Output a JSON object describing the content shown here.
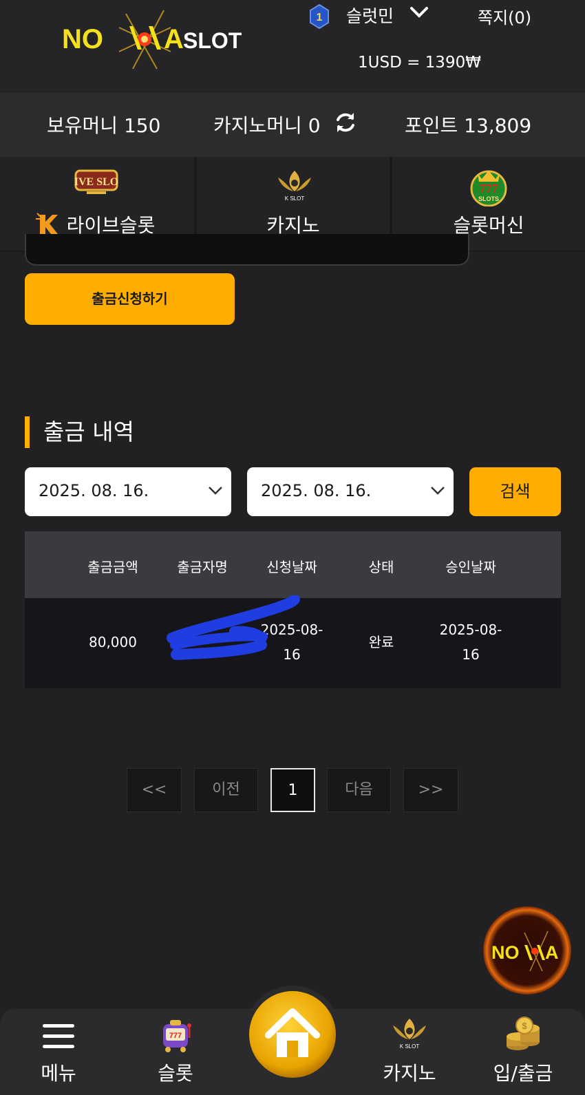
{
  "header": {
    "logo_text": "NOVA SLOT",
    "level": "1",
    "username": "슬럿민",
    "messages_label": "쪽지(0)",
    "exchange_rate": "1USD = 1390₩"
  },
  "balance": {
    "money": "보유머니 150",
    "casino_money": "카지노머니 0",
    "points": "포인트 13,809"
  },
  "categories": [
    {
      "label": "라이브슬롯",
      "icon_text": "LIVE SLOT"
    },
    {
      "label": "카지노",
      "icon_text": "K SLOT"
    },
    {
      "label": "슬롯머신",
      "icon_text": "777 SLOTS"
    }
  ],
  "main": {
    "withdraw_button": "출금신청하기",
    "section_title": "출금 내역",
    "date_from": "2025. 08. 16.",
    "date_to": "2025. 08. 16.",
    "search_button": "검색"
  },
  "table": {
    "headers": [
      "출금금액",
      "출금자명",
      "신청날짜",
      "상태",
      "승인날짜"
    ],
    "rows": [
      {
        "amount": "80,000",
        "name": "",
        "request_date_1": "2025-08-",
        "request_date_2": "16",
        "status": "완료",
        "approve_date_1": "2025-08-",
        "approve_date_2": "16"
      }
    ]
  },
  "pagination": {
    "first": "<<",
    "prev": "이전",
    "current": "1",
    "next": "다음",
    "last": ">>"
  },
  "bottom_nav": {
    "menu": "메뉴",
    "slot": "슬롯",
    "casino": "카지노",
    "deposit": "입/출금"
  },
  "colors": {
    "accent": "#ffad00",
    "background": "#212123",
    "redaction": "#1f3de0"
  }
}
